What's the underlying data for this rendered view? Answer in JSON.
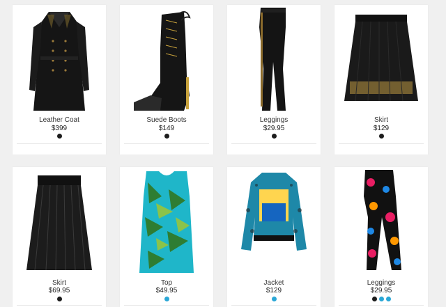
{
  "products": [
    {
      "name": "Leather Coat",
      "price": "$399",
      "swatches": [
        "#1c1c1c"
      ]
    },
    {
      "name": "Suede Boots",
      "price": "$149",
      "swatches": [
        "#1c1c1c"
      ]
    },
    {
      "name": "Leggings",
      "price": "$29.95",
      "swatches": [
        "#1c1c1c"
      ]
    },
    {
      "name": "Skirt",
      "price": "$129",
      "swatches": [
        "#1c1c1c"
      ]
    },
    {
      "name": "Skirt",
      "price": "$69.95",
      "swatches": [
        "#1c1c1c"
      ]
    },
    {
      "name": "Top",
      "price": "$49.95",
      "swatches": [
        "#2aa7d6"
      ]
    },
    {
      "name": "Jacket",
      "price": "$129",
      "swatches": [
        "#2aa7d6"
      ]
    },
    {
      "name": "Leggings",
      "price": "$29.95",
      "swatches": [
        "#1c1c1c",
        "#2aa7d6",
        "#2aa7d6"
      ]
    }
  ]
}
